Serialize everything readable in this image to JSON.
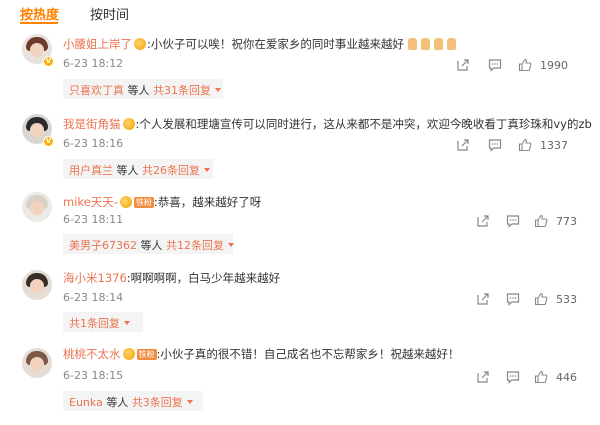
{
  "tabs": {
    "hot": "按热度",
    "time": "按时间"
  },
  "comments": [
    {
      "name": "小腰姐上岸了",
      "sep": ":",
      "text": "小伙子可以唉！祝你在爱家乡的同时事业越来越好",
      "time": "6-23 18:12",
      "likes": "1990",
      "reply_name": "只喜欢丁真",
      "reply_mid": "等人",
      "reply_total": "共31条回复"
    },
    {
      "name": "我是街角猫",
      "sep": ":",
      "text": "个人发展和理塘宣传可以同时进行，这从来都不是冲突，欢迎今晚收看丁真珍珠和vy的zb",
      "time": "6-23 18:16",
      "likes": "1337",
      "reply_name": "用户真兰",
      "reply_mid": "等人",
      "reply_total": "共26条回复"
    },
    {
      "name": "mike天天-",
      "fan_badge": "铁粉",
      "sep": ":",
      "text": "恭喜，越来越好了呀",
      "time": "6-23 18:11",
      "likes": "773",
      "reply_name": "美男子67362",
      "reply_mid": "等人",
      "reply_total": "共12条回复"
    },
    {
      "name": "海小米1376",
      "sep": ":",
      "text": "啊啊啊啊，白马少年越来越好",
      "time": "6-23 18:14",
      "likes": "533",
      "reply_total": "共1条回复"
    },
    {
      "name": "桃桃不太水",
      "fan_badge": "铁粉",
      "sep": ":",
      "text": "小伙子真的很不错！自己成名也不忘帮家乡！祝越来越好！",
      "time": "6-23 18:15",
      "likes": "446",
      "reply_name": "Eunka",
      "reply_mid": "等人",
      "reply_total": "共3条回复"
    }
  ],
  "colors": {
    "accent": "#ff8200",
    "username": "#eb7350",
    "reply_bg": "#f4f4f4"
  },
  "icons": [
    "share-icon",
    "comment-icon",
    "like-icon",
    "vip-badge-icon",
    "medal-icon",
    "thumbs-up-emoji",
    "chevron-down-icon"
  ]
}
